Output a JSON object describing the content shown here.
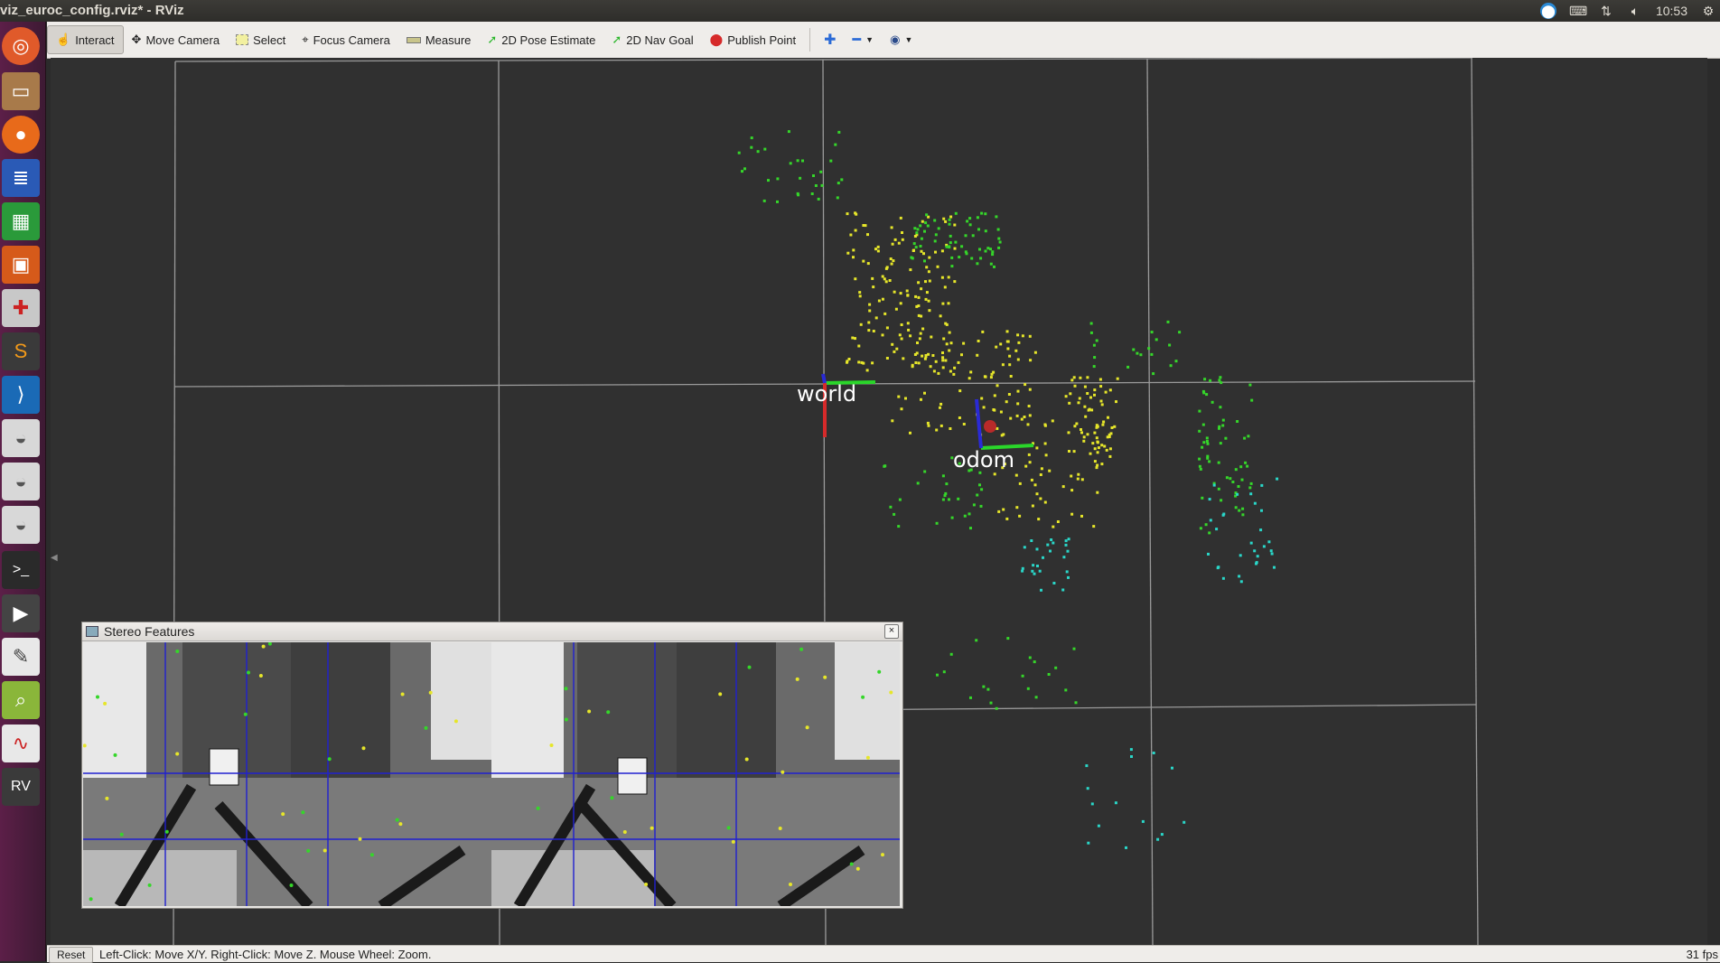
{
  "window": {
    "title": "viz_euroc_config.rviz* - RViz"
  },
  "tray": {
    "time": "10:53",
    "icons": [
      "accessibility-icon",
      "keyboard-icon",
      "network-icon",
      "volume-icon",
      "gear-icon"
    ]
  },
  "launcher": {
    "icons": [
      "ubuntu-icon",
      "files-icon",
      "firefox-icon",
      "writer-icon",
      "calc-icon",
      "impress-icon",
      "settings-icon",
      "sublime-icon",
      "vscode-icon",
      "disk-icon",
      "disk-icon",
      "disk-icon",
      "terminal-icon",
      "video-icon",
      "text-editor-icon",
      "search-icon",
      "app-icon",
      "rviz-icon"
    ]
  },
  "toolbar": {
    "tools": [
      {
        "label": "Interact",
        "icon": "hand-icon",
        "active": true
      },
      {
        "label": "Move Camera",
        "icon": "move-icon",
        "active": false
      },
      {
        "label": "Select",
        "icon": "select-icon",
        "active": false
      },
      {
        "label": "Focus Camera",
        "icon": "focus-icon",
        "active": false
      },
      {
        "label": "Measure",
        "icon": "ruler-icon",
        "active": false
      },
      {
        "label": "2D Pose Estimate",
        "icon": "arrow-green-icon",
        "active": false
      },
      {
        "label": "2D Nav Goal",
        "icon": "arrow-green-icon",
        "active": false
      },
      {
        "label": "Publish Point",
        "icon": "pin-icon",
        "active": false
      }
    ],
    "extra": [
      "plus-icon",
      "minus-icon",
      "eye-icon"
    ]
  },
  "viewport": {
    "frames": [
      {
        "label": "world"
      },
      {
        "label": "odom"
      }
    ],
    "colors": {
      "grid": "#a0a0a0",
      "bg": "#303030",
      "yellow": "#e6e62a",
      "green": "#35d62a",
      "cyan": "#2ad6c8",
      "blue": "#2a8ad6"
    }
  },
  "panel": {
    "title": "Stereo Features",
    "close": "×"
  },
  "status": {
    "reset": "Reset",
    "text": "Left-Click: Move X/Y. Right-Click: Move Z. Mouse Wheel: Zoom.",
    "fps": "31 fps"
  }
}
